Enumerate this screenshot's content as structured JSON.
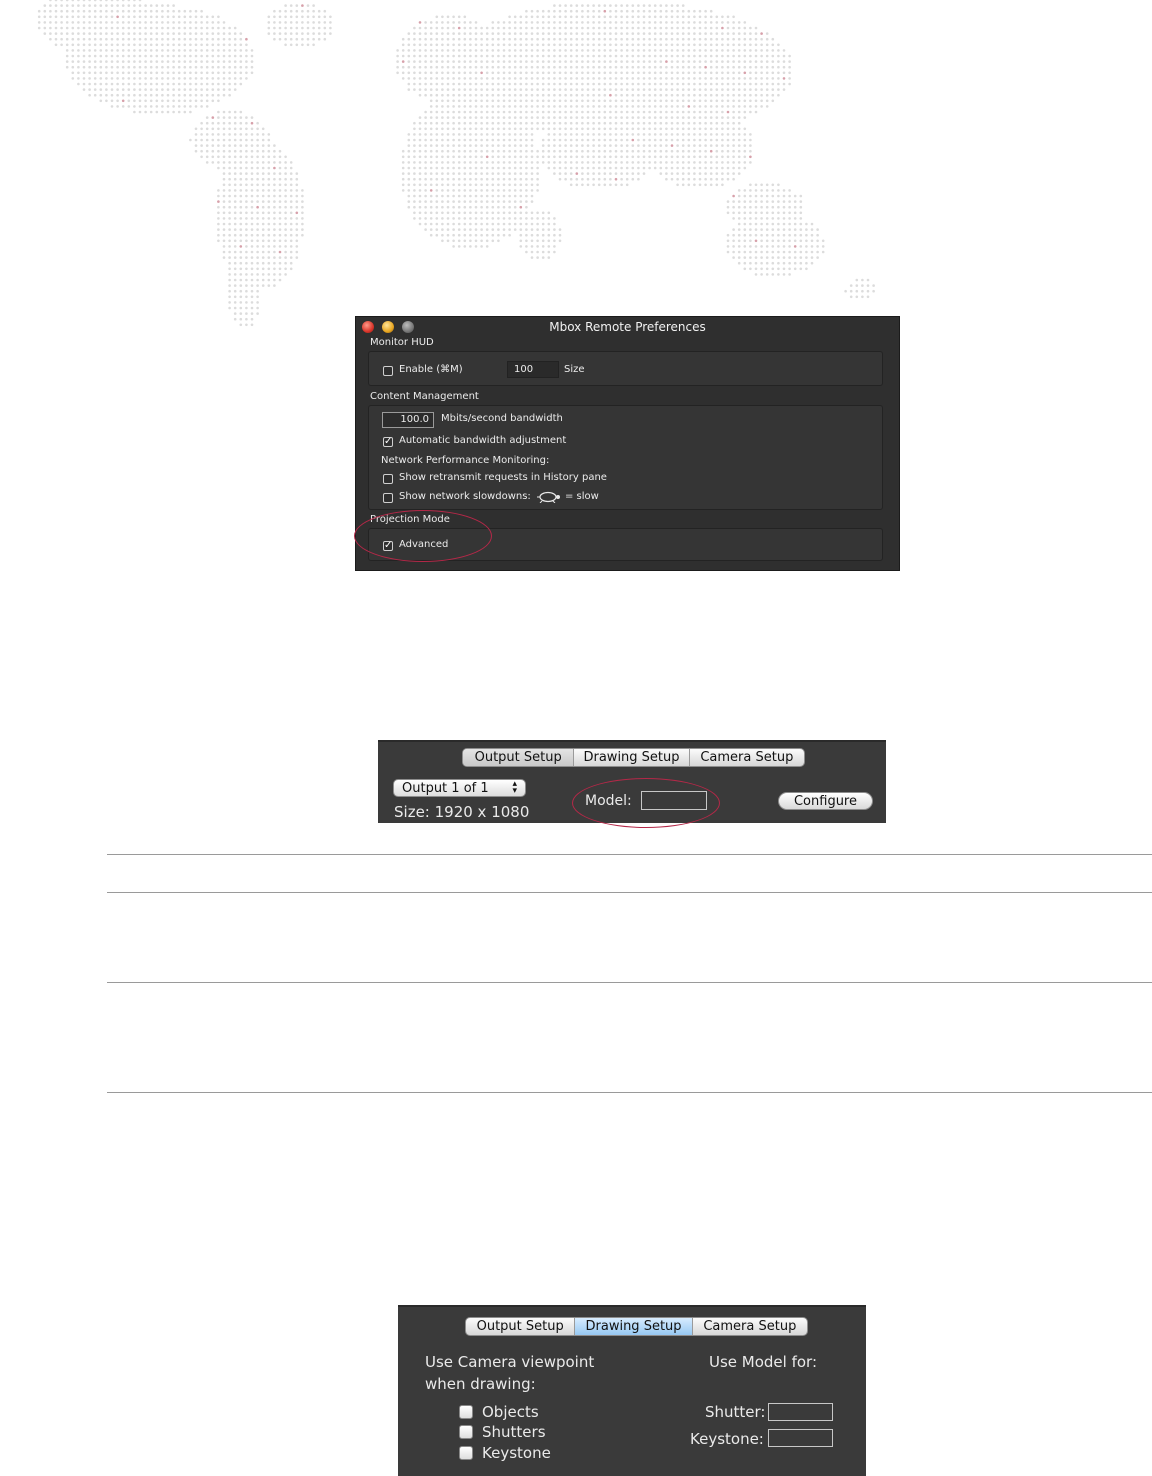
{
  "colors": {
    "map_dot": "#dcdcdc",
    "map_dot_accent": "#d7a0aa",
    "highlight": "#b42848",
    "panel_bg": "#3a3a3a"
  },
  "prefs_window": {
    "title": "Mbox Remote Preferences",
    "monitor_hud": {
      "heading": "Monitor HUD",
      "enable_label": "Enable (⌘M)",
      "enable_checked": false,
      "size_value": "100",
      "size_label": "Size"
    },
    "content_management": {
      "heading": "Content Management",
      "bandwidth_value": "100.0",
      "bandwidth_label": "Mbits/second bandwidth",
      "auto_label": "Automatic bandwidth adjustment",
      "auto_checked": true,
      "monitoring_heading": "Network Performance Monitoring:",
      "retransmit_label": "Show retransmit requests in History pane",
      "retransmit_checked": false,
      "slowdowns_label": "Show network slowdowns:",
      "slowdowns_suffix": "= slow",
      "slowdowns_checked": false
    },
    "projection_mode": {
      "heading": "Projection Mode",
      "advanced_label": "Advanced",
      "advanced_checked": true
    }
  },
  "output_panel": {
    "tabs": [
      "Output Setup",
      "Drawing Setup",
      "Camera Setup"
    ],
    "active_tab": "Output Setup",
    "output_select": "Output 1 of 1",
    "size_text": "Size: 1920 x 1080",
    "model_label": "Model:",
    "model_value": "",
    "configure_label": "Configure"
  },
  "drawing_panel": {
    "tabs": [
      "Output Setup",
      "Drawing Setup",
      "Camera Setup"
    ],
    "active_tab": "Drawing Setup",
    "camera_heading_line1": "Use Camera viewpoint",
    "camera_heading_line2": "when drawing:",
    "model_heading": "Use Model for:",
    "options": [
      "Objects",
      "Shutters",
      "Keystone"
    ],
    "shutter_label": "Shutter:",
    "keystone_label": "Keystone:"
  }
}
